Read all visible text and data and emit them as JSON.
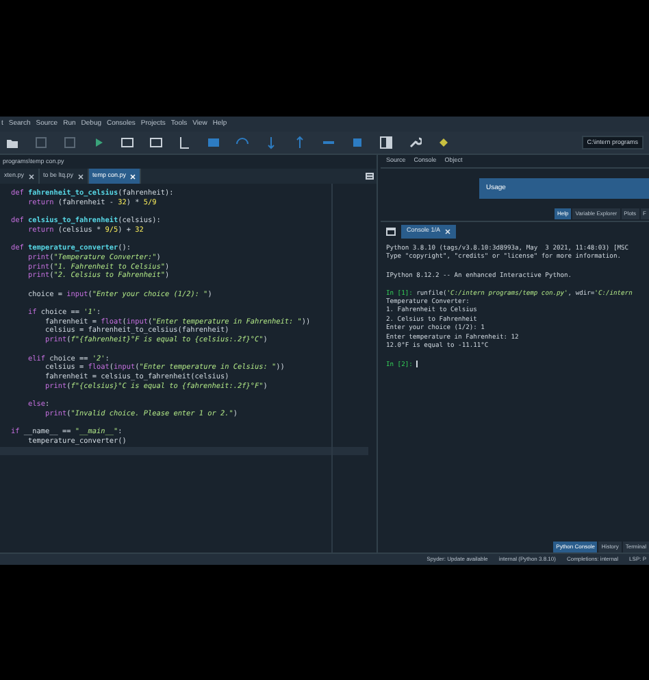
{
  "menu": [
    "t",
    "Search",
    "Source",
    "Run",
    "Debug",
    "Consoles",
    "Projects",
    "Tools",
    "View",
    "Help"
  ],
  "toolbar": {
    "path": "C:\\intern programs"
  },
  "editor": {
    "path": "programs\\temp con.py",
    "tabs": [
      {
        "label": "xten.py",
        "selected": false
      },
      {
        "label": "to be ltq.py",
        "selected": false
      },
      {
        "label": "temp con.py",
        "selected": true
      }
    ],
    "blocks": [
      [
        [
          {
            "kind": "keyword",
            "text": "def "
          },
          {
            "kind": "function",
            "text": "fahrenheit_to_celsius"
          },
          {
            "kind": "plain",
            "text": "(fahrenheit):"
          }
        ],
        [
          {
            "kind": "keyword",
            "text": "    return"
          },
          {
            "kind": "plain",
            "text": " (fahrenheit - "
          },
          {
            "kind": "number",
            "text": "32"
          },
          {
            "kind": "plain",
            "text": ") * "
          },
          {
            "kind": "number",
            "text": "5/9"
          }
        ]
      ],
      [
        [
          {
            "kind": "keyword",
            "text": "def "
          },
          {
            "kind": "function",
            "text": "celsius_to_fahrenheit"
          },
          {
            "kind": "plain",
            "text": "(celsius):"
          }
        ],
        [
          {
            "kind": "keyword",
            "text": "    return"
          },
          {
            "kind": "plain",
            "text": " (celsius * "
          },
          {
            "kind": "number",
            "text": "9/5"
          },
          {
            "kind": "plain",
            "text": ") + "
          },
          {
            "kind": "number",
            "text": "32"
          }
        ]
      ],
      [
        [
          {
            "kind": "keyword",
            "text": "def "
          },
          {
            "kind": "function",
            "text": "temperature_converter"
          },
          {
            "kind": "plain",
            "text": "():"
          }
        ],
        [
          {
            "kind": "keyword",
            "text": "    print"
          },
          {
            "kind": "plain",
            "text": "("
          },
          {
            "kind": "string",
            "text": "\"Temperature Converter:\""
          },
          {
            "kind": "plain",
            "text": ")"
          }
        ],
        [
          {
            "kind": "keyword",
            "text": "    print"
          },
          {
            "kind": "plain",
            "text": "("
          },
          {
            "kind": "string",
            "text": "\"1. Fahrenheit to Celsius\""
          },
          {
            "kind": "plain",
            "text": ")"
          }
        ],
        [
          {
            "kind": "keyword",
            "text": "    print"
          },
          {
            "kind": "plain",
            "text": "("
          },
          {
            "kind": "string",
            "text": "\"2. Celsius to Fahrenheit\""
          },
          {
            "kind": "plain",
            "text": ")"
          }
        ]
      ],
      [
        [
          {
            "kind": "plain",
            "text": "    choice = "
          },
          {
            "kind": "keyword",
            "text": "input"
          },
          {
            "kind": "plain",
            "text": "("
          },
          {
            "kind": "string",
            "text": "\"Enter your choice (1/2): \""
          },
          {
            "kind": "plain",
            "text": ")"
          }
        ]
      ],
      [
        [
          {
            "kind": "keyword",
            "text": "    if"
          },
          {
            "kind": "plain",
            "text": " choice == "
          },
          {
            "kind": "string",
            "text": "'1'"
          },
          {
            "kind": "plain",
            "text": ":"
          }
        ],
        [
          {
            "kind": "plain",
            "text": "        fahrenheit = "
          },
          {
            "kind": "keyword",
            "text": "float"
          },
          {
            "kind": "plain",
            "text": "("
          },
          {
            "kind": "keyword",
            "text": "input"
          },
          {
            "kind": "plain",
            "text": "("
          },
          {
            "kind": "string",
            "text": "\"Enter temperature in Fahrenheit: \""
          },
          {
            "kind": "plain",
            "text": "))"
          }
        ],
        [
          {
            "kind": "plain",
            "text": "        celsius = fahrenheit_to_celsius(fahrenheit)"
          }
        ],
        [
          {
            "kind": "keyword",
            "text": "        print"
          },
          {
            "kind": "plain",
            "text": "("
          },
          {
            "kind": "string",
            "text": "f\"{fahrenheit}°F is equal to {celsius:.2f}°C\""
          },
          {
            "kind": "plain",
            "text": ")"
          }
        ]
      ],
      [
        [
          {
            "kind": "keyword",
            "text": "    elif"
          },
          {
            "kind": "plain",
            "text": " choice == "
          },
          {
            "kind": "string",
            "text": "'2'"
          },
          {
            "kind": "plain",
            "text": ":"
          }
        ],
        [
          {
            "kind": "plain",
            "text": "        celsius = "
          },
          {
            "kind": "keyword",
            "text": "float"
          },
          {
            "kind": "plain",
            "text": "("
          },
          {
            "kind": "keyword",
            "text": "input"
          },
          {
            "kind": "plain",
            "text": "("
          },
          {
            "kind": "string",
            "text": "\"Enter temperature in Celsius: \""
          },
          {
            "kind": "plain",
            "text": "))"
          }
        ],
        [
          {
            "kind": "plain",
            "text": "        fahrenheit = celsius_to_fahrenheit(celsius)"
          }
        ],
        [
          {
            "kind": "keyword",
            "text": "        print"
          },
          {
            "kind": "plain",
            "text": "("
          },
          {
            "kind": "string",
            "text": "f\"{celsius}°C is equal to {fahrenheit:.2f}°F\""
          },
          {
            "kind": "plain",
            "text": ")"
          }
        ]
      ],
      [
        [
          {
            "kind": "keyword",
            "text": "    else"
          },
          {
            "kind": "plain",
            "text": ":"
          }
        ],
        [
          {
            "kind": "keyword",
            "text": "        print"
          },
          {
            "kind": "plain",
            "text": "("
          },
          {
            "kind": "string",
            "text": "\"Invalid choice. Please enter 1 or 2.\""
          },
          {
            "kind": "plain",
            "text": ")"
          }
        ]
      ],
      [
        [
          {
            "kind": "keyword",
            "text": "if"
          },
          {
            "kind": "plain",
            "text": " __name__ == "
          },
          {
            "kind": "string",
            "text": "\"__main__\""
          },
          {
            "kind": "plain",
            "text": ":"
          }
        ],
        [
          {
            "kind": "plain",
            "text": "    temperature_converter()"
          }
        ]
      ]
    ]
  },
  "help": {
    "tabs": [
      {
        "label": "Source",
        "selected": false
      },
      {
        "label": "Console",
        "selected": false
      },
      {
        "label": "Object",
        "selected": false
      }
    ],
    "usage": "Usage",
    "pane_tabs": [
      {
        "label": "Help",
        "selected": true
      },
      {
        "label": "Variable Explorer",
        "selected": false
      },
      {
        "label": "Plots",
        "selected": false
      },
      {
        "label": "F",
        "selected": false
      }
    ]
  },
  "console": {
    "tab": "Console 1/A",
    "blocks": [
      [
        [
          {
            "kind": "plain",
            "text": "Python 3.8.10 (tags/v3.8.10:3d8993a, May  3 2021, 11:48:03) [MSC"
          }
        ],
        [
          {
            "kind": "plain",
            "text": "Type \"copyright\", \"credits\" or \"license\" for more information."
          }
        ]
      ],
      [
        [
          {
            "kind": "plain",
            "text": "IPython 8.12.2 -- An enhanced Interactive Python."
          }
        ]
      ],
      [
        [
          {
            "kind": "prompt",
            "text": "In [1]: "
          },
          {
            "kind": "plain",
            "text": "runfile("
          },
          {
            "kind": "string",
            "text": "'C:/intern programs/temp con.py'"
          },
          {
            "kind": "plain",
            "text": ", wdir="
          },
          {
            "kind": "string",
            "text": "'C:/intern"
          }
        ],
        [
          {
            "kind": "plain",
            "text": "Temperature Converter:"
          }
        ],
        [
          {
            "kind": "plain",
            "text": "1. Fahrenheit to Celsius"
          }
        ],
        [
          {
            "kind": "plain",
            "text": "2. Celsius to Fahrenheit"
          }
        ],
        [
          {
            "kind": "plain",
            "text": "Enter your choice (1/2): 1"
          }
        ],
        [
          {
            "kind": "plain",
            "text": "Enter temperature in Fahrenheit: 12"
          }
        ],
        [
          {
            "kind": "plain",
            "text": "12.0°F is equal to -11.11°C"
          }
        ]
      ],
      [
        [
          {
            "kind": "prompt",
            "text": "In [2]: "
          }
        ]
      ]
    ],
    "pane_tabs": [
      {
        "label": "Python Console",
        "selected": true
      },
      {
        "label": "History",
        "selected": false
      },
      {
        "label": "Terminal",
        "selected": false
      }
    ]
  },
  "status_bar": [
    "Spyder: Update available",
    "internal (Python 3.8.10)",
    "Completions: internal",
    "LSP: P"
  ]
}
